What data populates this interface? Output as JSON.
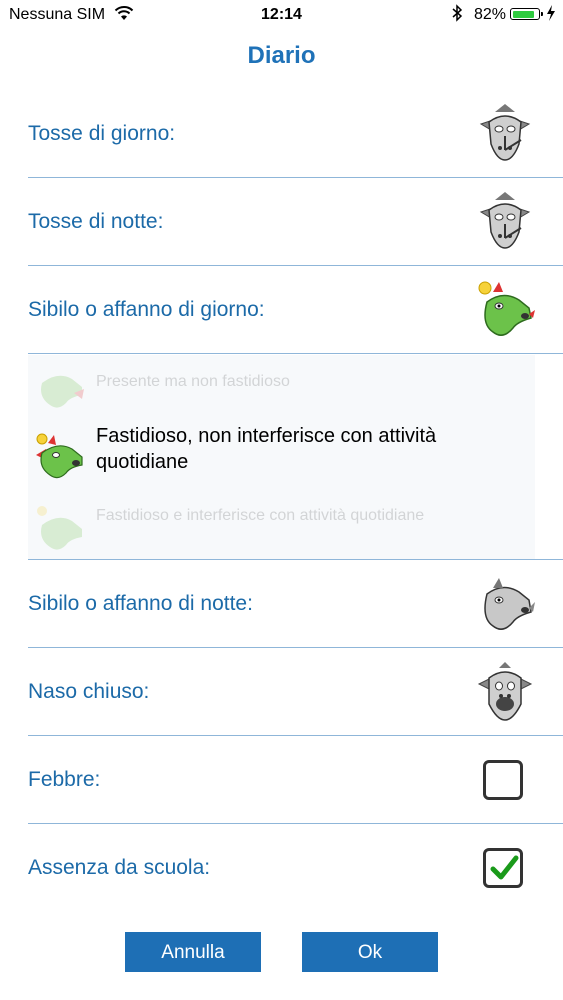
{
  "status_bar": {
    "carrier": "Nessuna SIM",
    "time": "12:14",
    "battery_percent": "82%",
    "battery_level": 0.82,
    "battery_color": "#2fcb3f"
  },
  "title": "Diario",
  "rows": [
    {
      "label": "Tosse di giorno:",
      "control": "image",
      "icon": "gray-creature-icon"
    },
    {
      "label": "Tosse di notte:",
      "control": "image",
      "icon": "gray-creature-icon"
    },
    {
      "label": "Sibilo o affanno di giorno:",
      "control": "image",
      "icon": "green-dragon-icon"
    }
  ],
  "picker": {
    "options": [
      {
        "label": "Presente ma non fastidioso",
        "state": "dimmed"
      },
      {
        "label": "Fastidioso, non interferisce con attività quotidiane",
        "state": "selected"
      },
      {
        "label": "Fastidioso e interferisce con attività quotidiane",
        "state": "dimmed"
      }
    ]
  },
  "rows_after": [
    {
      "label": "Sibilo o affanno di notte:",
      "control": "image",
      "icon": "gray-dragon-icon"
    },
    {
      "label": "Naso chiuso:",
      "control": "image",
      "icon": "gray-dragon-face-icon"
    },
    {
      "label": "Febbre:",
      "control": "checkbox",
      "checked": false
    },
    {
      "label": "Assenza da scuola:",
      "control": "checkbox",
      "checked": true
    }
  ],
  "buttons": {
    "cancel": "Annulla",
    "ok": "Ok"
  },
  "colors": {
    "accent": "#1e6fb5",
    "label": "#1c6aa8",
    "divider": "#8fb6d9",
    "check": "#1a9a1a"
  }
}
